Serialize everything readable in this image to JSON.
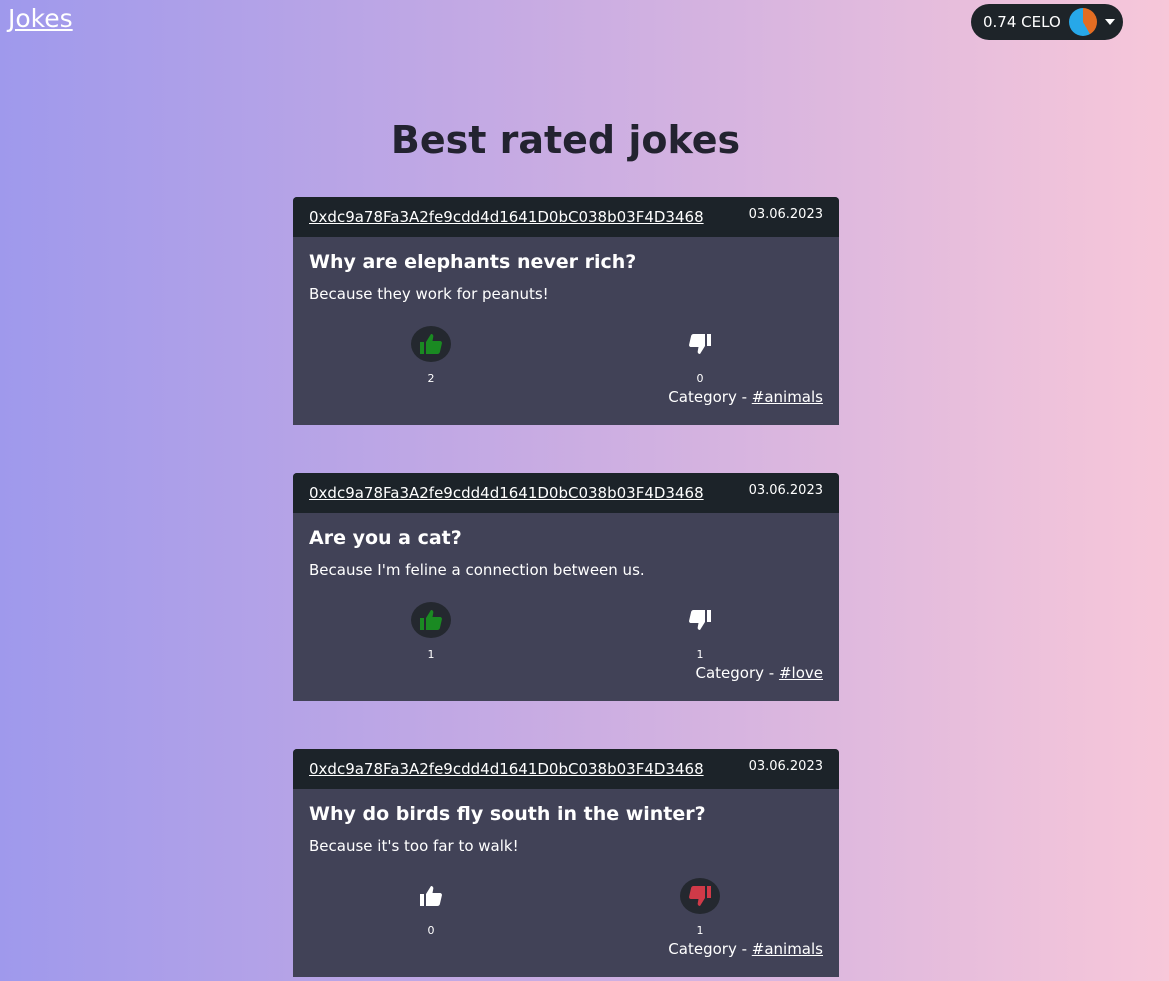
{
  "brand": "Jokes",
  "wallet": {
    "balance": "0.74 CELO"
  },
  "page_title": "Best rated jokes",
  "jokes": [
    {
      "address": "0xdc9a78Fa3A2fe9cdd4d1641D0bC038b03F4D3468",
      "date": "03.06.2023",
      "title": "Why are elephants never rich?",
      "text": "Because they work for peanuts!",
      "likes": "2",
      "dislikes": "0",
      "category_label": "Category - ",
      "category": "#animals",
      "liked": true,
      "disliked": false
    },
    {
      "address": "0xdc9a78Fa3A2fe9cdd4d1641D0bC038b03F4D3468",
      "date": "03.06.2023",
      "title": "Are you a cat?",
      "text": "Because I'm feline a connection between us.",
      "likes": "1",
      "dislikes": "1",
      "category_label": "Category - ",
      "category": "#love",
      "liked": true,
      "disliked": false
    },
    {
      "address": "0xdc9a78Fa3A2fe9cdd4d1641D0bC038b03F4D3468",
      "date": "03.06.2023",
      "title": "Why do birds fly south in the winter?",
      "text": "Because it's too far to walk!",
      "likes": "0",
      "dislikes": "1",
      "category_label": "Category - ",
      "category": "#animals",
      "liked": false,
      "disliked": true
    }
  ],
  "colors": {
    "like_active": "#1a8a22",
    "dislike_active": "#d03a48",
    "inactive": "#ffffff"
  }
}
